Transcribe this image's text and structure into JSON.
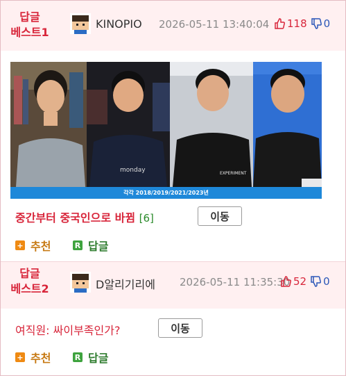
{
  "comments": [
    {
      "badge_line1": "답글",
      "badge_line2": "베스트1",
      "nickname": "KINOPIO",
      "date": "2026-05-11 13:40:04",
      "upvotes": "118",
      "downvotes": "0",
      "title": "중간부터 중국인으로 바뀜",
      "reply_count": "[6]",
      "move_label": "이동",
      "recommend_label": "추천",
      "reply_label": "답글",
      "video_caption": "각각 2018/2019/2021/2023년"
    },
    {
      "badge_line1": "답글",
      "badge_line2": "베스트2",
      "nickname": "D알리기리에",
      "date": "2026-05-11 11:35:30",
      "upvotes": "52",
      "downvotes": "0",
      "title": "여직원: 싸이부족인가?",
      "move_label": "이동",
      "recommend_label": "추천",
      "reply_label": "답글"
    }
  ],
  "icons": {
    "avatar": "pixel-avatar-icon",
    "upvote": "thumbs-up-icon",
    "downvote": "thumbs-down-icon",
    "recommend": "plus-square-icon",
    "reply": "r-square-icon"
  },
  "colors": {
    "accent_red": "#d8253a",
    "accent_blue": "#2a56b8",
    "header_bg": "#fff0f1",
    "recommend_orange": "#ef8a13",
    "reply_green": "#3ea33e"
  }
}
